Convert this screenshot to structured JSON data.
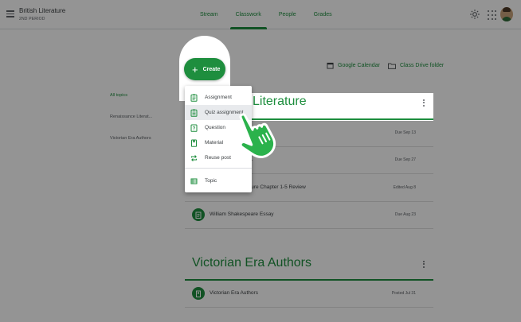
{
  "header": {
    "class_name": "British Literature",
    "class_section": "2ND PERIOD",
    "tabs": [
      {
        "label": "Stream"
      },
      {
        "label": "Classwork"
      },
      {
        "label": "People"
      },
      {
        "label": "Grades"
      }
    ],
    "active_tab": "Classwork"
  },
  "toolbar": {
    "create_label": "Create",
    "calendar_label": "Google Calendar",
    "drive_label": "Class Drive folder"
  },
  "create_menu": {
    "items": [
      {
        "label": "Assignment",
        "icon": "assignment-icon"
      },
      {
        "label": "Quiz assignment",
        "icon": "quiz-assignment-icon"
      },
      {
        "label": "Question",
        "icon": "question-icon"
      },
      {
        "label": "Material",
        "icon": "material-icon"
      },
      {
        "label": "Reuse post",
        "icon": "reuse-post-icon"
      },
      {
        "label": "Topic",
        "icon": "topic-icon"
      }
    ],
    "hovered_item": "Quiz assignment"
  },
  "topics_nav": {
    "items": [
      {
        "label": "All topics"
      },
      {
        "label": "Renaissance Literat..."
      },
      {
        "label": "Victorian Era Authors"
      }
    ],
    "active": "All topics"
  },
  "sections": [
    {
      "title_visible": "Literature",
      "items": [
        {
          "title": "",
          "meta": "Due Sep 13"
        },
        {
          "title": "...",
          "meta": "Due Sep 27"
        },
        {
          "title": "...ture Chapter 1-5 Review",
          "meta": "Edited Aug 8"
        },
        {
          "title": "William Shakespeare Essay",
          "meta": "Due Aug 23"
        }
      ]
    },
    {
      "title": "Victorian Era Authors",
      "items": [
        {
          "title": "Victorian Era Authors",
          "meta": "Posted Jul 31"
        }
      ]
    }
  ],
  "colors": {
    "accent": "#1e8e3e",
    "overlay": "rgba(0,0,0,0.42)",
    "hand": "#2bb24c"
  }
}
